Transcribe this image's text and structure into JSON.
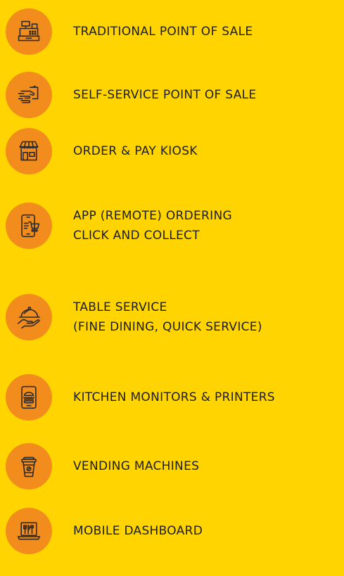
{
  "theme": {
    "background": "#FFD400",
    "badge_color": "#F28C1C",
    "icon_stroke": "#2B2B2B",
    "text_color": "#1E1E1E"
  },
  "items": [
    {
      "icon": "cash-register-icon",
      "lines": [
        "TRADITIONAL POINT OF SALE"
      ]
    },
    {
      "icon": "card-payment-hand-icon",
      "lines": [
        "SELF-SERVICE POINT OF SALE"
      ]
    },
    {
      "icon": "kiosk-storefront-icon",
      "lines": [
        "ORDER & PAY KIOSK"
      ]
    },
    {
      "icon": "mobile-cart-icon",
      "lines": [
        "APP (REMOTE) ORDERING",
        "CLICK AND COLLECT"
      ]
    },
    {
      "icon": "cloche-hand-icon",
      "lines": [
        "TABLE SERVICE",
        "(FINE DINING, QUICK SERVICE)"
      ]
    },
    {
      "icon": "tablet-burger-icon",
      "lines": [
        "KITCHEN MONITORS & PRINTERS"
      ]
    },
    {
      "icon": "coffee-cup-icon",
      "lines": [
        "VENDING MACHINES"
      ]
    },
    {
      "icon": "laptop-cutlery-icon",
      "lines": [
        "MOBILE DASHBOARD"
      ]
    }
  ]
}
